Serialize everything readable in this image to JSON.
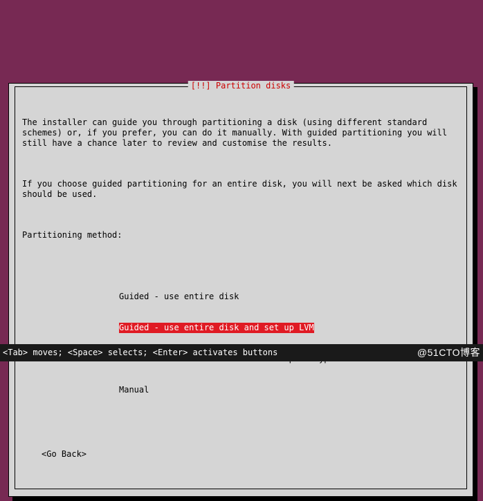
{
  "dialog": {
    "title": "[!!] Partition disks",
    "para1": "The installer can guide you through partitioning a disk (using different standard schemes) or, if you prefer, you can do it manually. With guided partitioning you will still have a chance later to review and customise the results.",
    "para2": "If you choose guided partitioning for an entire disk, you will next be asked which disk should be used.",
    "prompt": "Partitioning method:",
    "options": [
      "Guided - use entire disk",
      "Guided - use entire disk and set up LVM",
      "Guided - use entire disk and set up encrypted LVM",
      "Manual"
    ],
    "selected_index": 1,
    "go_back": "<Go Back>"
  },
  "footer": {
    "help": "<Tab> moves; <Space> selects; <Enter> activates buttons",
    "watermark": "@51CTO博客"
  }
}
